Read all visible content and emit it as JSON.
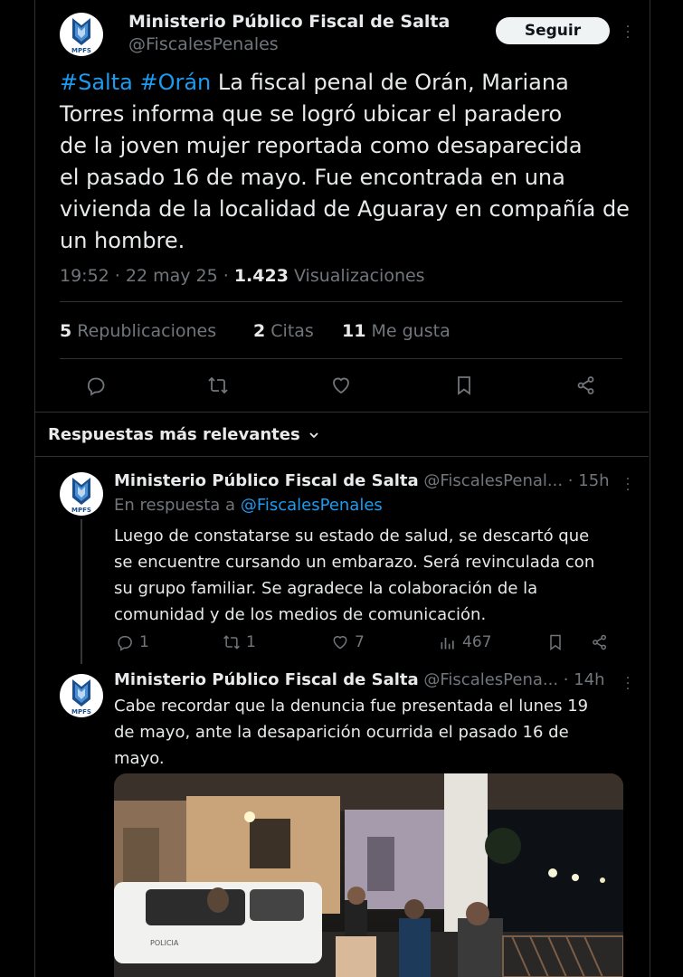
{
  "main_tweet": {
    "account_name": "Ministerio Público Fiscal de Salta",
    "handle": "@FiscalesPenales",
    "follow_label": "Seguir",
    "avatar_text": "MPFS",
    "hashtag1": "#Salta",
    "hashtag2": "#Orán",
    "text_line1": " La fiscal penal de Orán, Mariana",
    "text_line2": "Torres informa que se logró ubicar el paradero",
    "text_line3": "de la joven mujer reportada como desaparecida",
    "text_line4": "el pasado 16 de mayo. Fue encontrada en una",
    "text_line5": "vivienda de la localidad de Aguaray en compañía de",
    "text_line6": "un hombre.",
    "time": "19:52 · 22 may 25 · ",
    "views_count": "1.423",
    "views_label": " Visualizaciones",
    "reposts_count": "5",
    "reposts_label": " Republicaciones",
    "quotes_count": "2",
    "quotes_label": " Citas",
    "likes_count": "11",
    "likes_label": " Me gusta"
  },
  "replies_header": {
    "label": "Respuestas más relevantes"
  },
  "reply1": {
    "account_name": "Ministerio Público Fiscal de Salta",
    "handle": "@FiscalesPenal...",
    "dot": " · ",
    "time": "15h",
    "in_reply_to": "En respuesta a ",
    "in_reply_handle": "@FiscalesPenales",
    "text_line1": "Luego de constatarse su estado de salud, se descartó que",
    "text_line2": "se encuentre cursando un embarazo. Será revinculada con",
    "text_line3": "su grupo familiar. Se agradece la colaboración de la",
    "text_line4": "comunidad y de los medios de comunicación.",
    "replies": "1",
    "reposts": "1",
    "likes": "7",
    "views": "467"
  },
  "reply2": {
    "account_name": "Ministerio Público Fiscal de Salta",
    "handle": "@FiscalesPena...",
    "dot": " · ",
    "time": "14h",
    "text_line1": "Cabe recordar que la denuncia fue presentada el lunes 19",
    "text_line2": "de mayo, ante la desaparición ocurrida el pasado 16 de",
    "text_line3": "mayo.",
    "truck_label": "POLICIA"
  },
  "icons": {
    "reply": "reply-icon",
    "repost": "repost-icon",
    "like": "heart-icon",
    "bookmark": "bookmark-icon",
    "share": "share-icon",
    "views": "views-icon",
    "more": "more-icon",
    "chevron": "chevron-down-icon"
  },
  "colors": {
    "background": "#000000",
    "text": "#e7e9ea",
    "secondary": "#71767b",
    "link": "#1d9bf0",
    "divider": "#2f3336",
    "button_bg": "#eff3f4"
  }
}
